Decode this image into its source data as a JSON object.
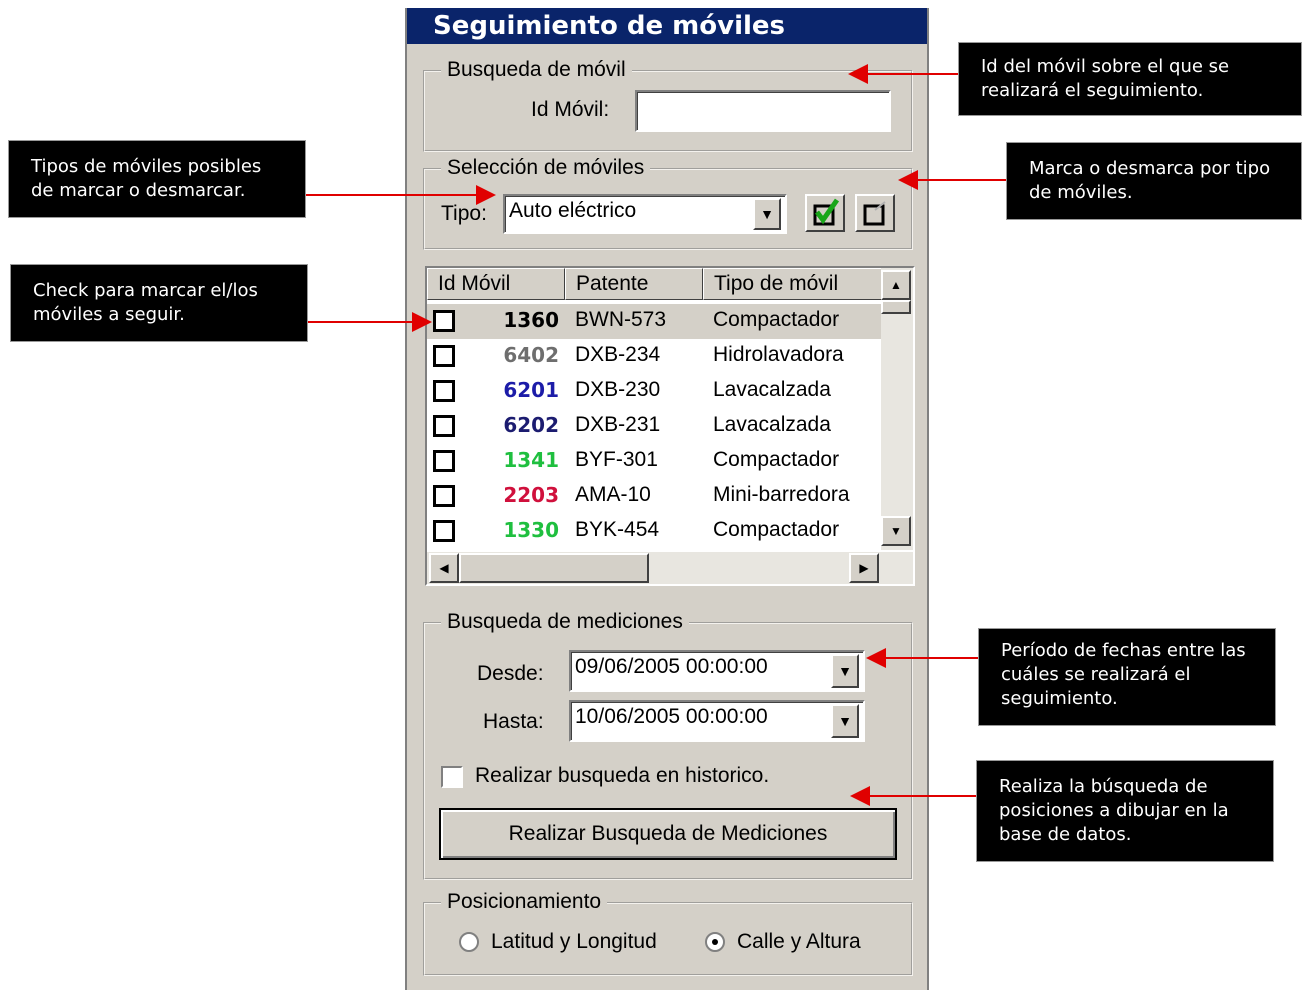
{
  "window": {
    "title": "Seguimiento de móviles"
  },
  "busqueda_movil": {
    "legend": "Busqueda de móvil",
    "id_label": "Id Móvil:",
    "id_value": ""
  },
  "seleccion": {
    "legend": "Selección de móviles",
    "tipo_label": "Tipo:",
    "tipo_value": "Auto eléctrico",
    "mark_button": "check-all",
    "unmark_button": "uncheck-all"
  },
  "table": {
    "headers": [
      "Id Móvil",
      "Patente",
      "Tipo de móvil"
    ],
    "rows": [
      {
        "id": "1360",
        "patente": "BWN-573",
        "tipo": "Compactador",
        "color": "#000000",
        "selected": true
      },
      {
        "id": "6402",
        "patente": "DXB-234",
        "tipo": "Hidrolavadora",
        "color": "#6e6e6e",
        "selected": false
      },
      {
        "id": "6201",
        "patente": "DXB-230",
        "tipo": "Lavacalzada",
        "color": "#1c1ca8",
        "selected": false
      },
      {
        "id": "6202",
        "patente": "DXB-231",
        "tipo": "Lavacalzada",
        "color": "#1c1c70",
        "selected": false
      },
      {
        "id": "1341",
        "patente": "BYF-301",
        "tipo": "Compactador",
        "color": "#1fbf3f",
        "selected": false
      },
      {
        "id": "2203",
        "patente": "AMA-10",
        "tipo": "Mini-barredora",
        "color": "#d0103c",
        "selected": false
      },
      {
        "id": "1330",
        "patente": "BYK-454",
        "tipo": "Compactador",
        "color": "#1fbf3f",
        "selected": false
      }
    ]
  },
  "mediciones": {
    "legend": "Busqueda de mediciones",
    "desde_label": "Desde:",
    "desde_value": "09/06/2005 00:00:00",
    "hasta_label": "Hasta:",
    "hasta_value": "10/06/2005 00:00:00",
    "historico_label": "Realizar busqueda en historico.",
    "button_label": "Realizar Busqueda de Mediciones"
  },
  "posicionamiento": {
    "legend": "Posicionamiento",
    "option1": "Latitud y Longitud",
    "option2": "Calle y Altura",
    "selected": "Calle y Altura"
  },
  "callouts": {
    "id_movil": "Id del móvil sobre el que se realizará el seguimiento.",
    "tipos": "Tipos de móviles posibles de marcar o desmarcar.",
    "marca": "Marca o desmarca por tipo de móviles.",
    "check": "Check para marcar el/los móviles a seguir.",
    "periodo": "Período de fechas entre las cuáles se realizará el seguimiento.",
    "realiza": "Realiza la búsqueda de posiciones a dibujar en la base de datos."
  },
  "colors": {
    "titlebar": "#0a246a",
    "arrow": "#e00000",
    "callout_bg": "#000000"
  }
}
